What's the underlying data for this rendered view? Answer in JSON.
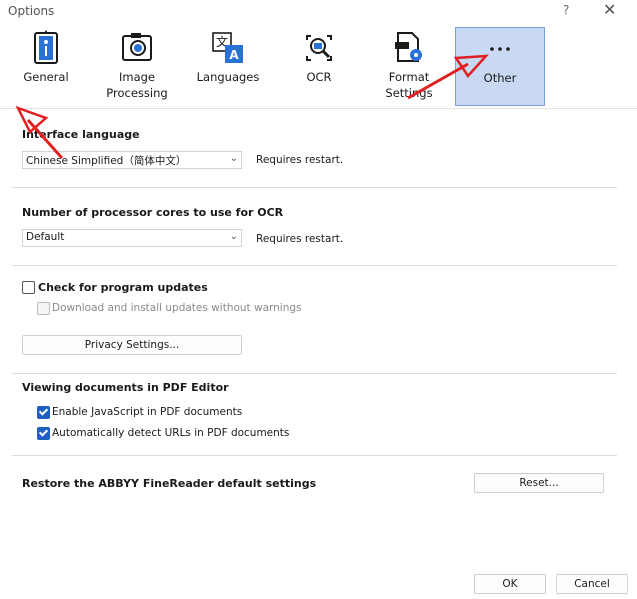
{
  "window": {
    "title": "Options",
    "help": "?",
    "close": "✕"
  },
  "tabs": [
    {
      "label": "General",
      "icon": "general-icon"
    },
    {
      "label": "Image\nProcessing",
      "icon": "image-processing-icon"
    },
    {
      "label": "Languages",
      "icon": "languages-icon"
    },
    {
      "label": "OCR",
      "icon": "ocr-icon"
    },
    {
      "label": "Format\nSettings",
      "icon": "format-settings-icon"
    },
    {
      "label": "Other",
      "icon": "more-icon",
      "selected": true
    }
  ],
  "interface_language": {
    "title": "Interface language",
    "value": "Chinese Simplified（简体中文）",
    "note": "Requires restart."
  },
  "processor_cores": {
    "title": "Number of processor cores to use for OCR",
    "value": "Default",
    "note": "Requires restart."
  },
  "updates": {
    "check_label": "Check for program updates",
    "check_checked": false,
    "download_label": "Download and install updates without warnings",
    "download_checked": false,
    "privacy_button": "Privacy Settings..."
  },
  "pdf_editor": {
    "title": "Viewing documents in PDF Editor",
    "js_label": "Enable JavaScript in PDF documents",
    "js_checked": true,
    "urls_label": "Automatically detect URLs in PDF documents",
    "urls_checked": true
  },
  "restore": {
    "title": "Restore the ABBYY FineReader default settings",
    "reset_button": "Reset..."
  },
  "footer": {
    "ok": "OK",
    "cancel": "Cancel"
  },
  "colors": {
    "selected_tab_bg": "#c9d9f4",
    "checkbox": "#1e5fbf",
    "annotation_arrow": "#e02020"
  }
}
